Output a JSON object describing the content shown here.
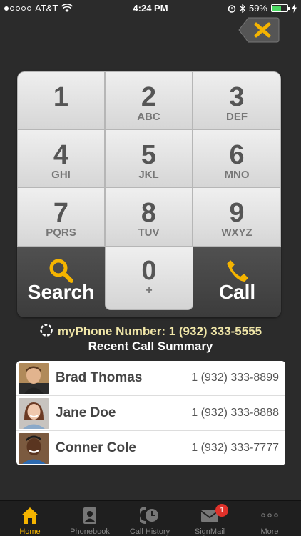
{
  "status_bar": {
    "carrier": "AT&T",
    "time": "4:24 PM",
    "battery_percent": "59%",
    "battery_level": 0.59
  },
  "keypad": {
    "keys": [
      {
        "num": "1",
        "letters": ""
      },
      {
        "num": "2",
        "letters": "ABC"
      },
      {
        "num": "3",
        "letters": "DEF"
      },
      {
        "num": "4",
        "letters": "GHI"
      },
      {
        "num": "5",
        "letters": "JKL"
      },
      {
        "num": "6",
        "letters": "MNO"
      },
      {
        "num": "7",
        "letters": "PQRS"
      },
      {
        "num": "8",
        "letters": "TUV"
      },
      {
        "num": "9",
        "letters": "WXYZ"
      }
    ],
    "zero": {
      "num": "0",
      "letters": "+"
    },
    "search_label": "Search",
    "call_label": "Call"
  },
  "my_number": "myPhone Number: 1 (932) 333-5555",
  "recent_title": "Recent Call Summary",
  "recent_calls": [
    {
      "name": "Brad Thomas",
      "phone": "1 (932) 333-8899"
    },
    {
      "name": "Jane Doe",
      "phone": "1 (932) 333-8888"
    },
    {
      "name": "Conner Cole",
      "phone": "1 (932) 333-7777"
    }
  ],
  "tabs": [
    {
      "label": "Home",
      "icon": "home-icon"
    },
    {
      "label": "Phonebook",
      "icon": "phonebook-icon"
    },
    {
      "label": "Call History",
      "icon": "call-history-icon"
    },
    {
      "label": "SignMail",
      "icon": "signmail-icon",
      "badge": "1"
    },
    {
      "label": "More",
      "icon": "more-icon"
    }
  ],
  "colors": {
    "accent": "#f5b400",
    "background": "#2b2b2b",
    "badge": "#e0312a"
  }
}
